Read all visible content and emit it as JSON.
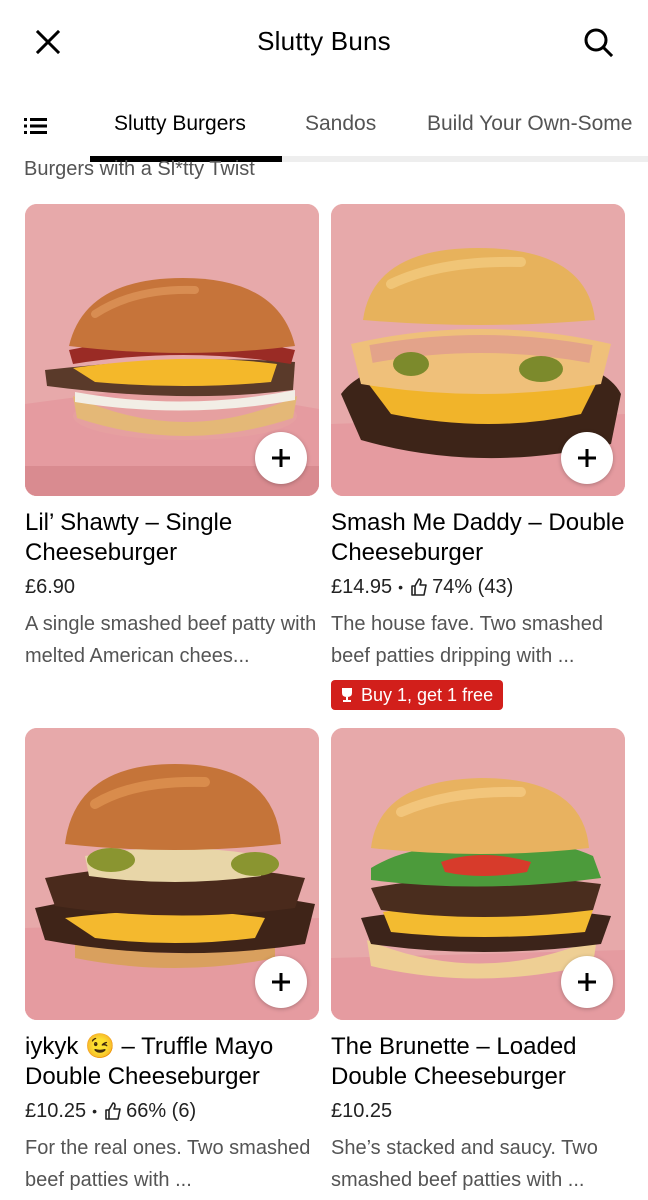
{
  "header": {
    "title": "Slutty Buns",
    "close_icon": "close-icon",
    "search_icon": "search-icon"
  },
  "tabs": {
    "menu_icon": "list-menu-icon",
    "items": [
      {
        "label": "Slutty Burgers",
        "active": true
      },
      {
        "label": "Sandos",
        "active": false
      },
      {
        "label": "Build Your Own-Some",
        "active": false
      }
    ]
  },
  "section": {
    "subtitle": "Burgers with a Sl*tty Twist"
  },
  "items": [
    {
      "name": "Lil’ Shawty – Single Cheeseburger",
      "price": "£6.90",
      "rating": "",
      "description": "A single smashed beef patty with melted American chees...",
      "promo": ""
    },
    {
      "name": "Smash Me Daddy – Double Cheeseburger",
      "price": "£14.95",
      "rating": "74% (43)",
      "description": "The house fave. Two smashed beef patties dripping with ...",
      "promo": "Buy 1, get 1 free"
    },
    {
      "name": "iykyk 😉 – Truffle Mayo Double Cheeseburger",
      "price": "£10.25",
      "rating": "66% (6)",
      "description": "For the real ones. Two smashed beef patties with ...",
      "promo": ""
    },
    {
      "name": "The Brunette – Loaded Double Cheeseburger",
      "price": "£10.25",
      "rating": "",
      "description": "She’s stacked and saucy. Two smashed beef patties with ...",
      "promo": ""
    }
  ],
  "colors": {
    "promo_bg": "#d21f1b",
    "image_bg": "#e5a6a6",
    "active_tab": "#000000",
    "inactive_tab": "#545454"
  }
}
